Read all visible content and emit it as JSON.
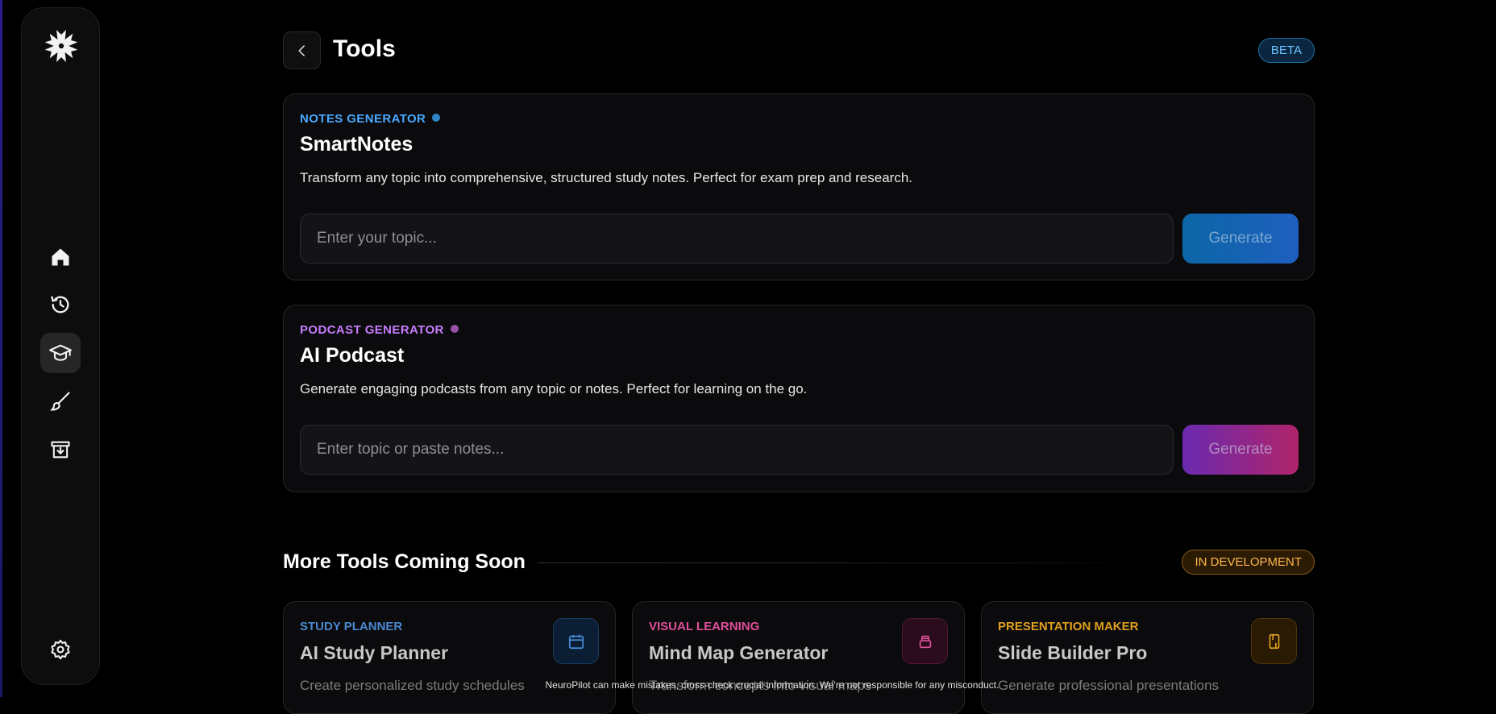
{
  "header": {
    "title": "Tools",
    "badge": "BETA"
  },
  "tools": [
    {
      "eyebrow": "NOTES GENERATOR",
      "title": "SmartNotes",
      "description": "Transform any topic into comprehensive, structured study notes. Perfect for exam prep and research.",
      "placeholder": "Enter your topic...",
      "button": "Generate",
      "accent": "#4aa8ff"
    },
    {
      "eyebrow": "PODCAST GENERATOR",
      "title": "AI Podcast",
      "description": "Generate engaging podcasts from any topic or notes. Perfect for learning on the go.",
      "placeholder": "Enter topic or paste notes...",
      "button": "Generate",
      "accent": "#c87cff"
    }
  ],
  "coming_soon": {
    "title": "More Tools Coming Soon",
    "badge": "IN DEVELOPMENT",
    "cards": [
      {
        "eyebrow": "STUDY PLANNER",
        "title": "AI Study Planner",
        "description": "Create personalized study schedules",
        "icon": "calendar-icon",
        "accent": "#4a88d0"
      },
      {
        "eyebrow": "VISUAL LEARNING",
        "title": "Mind Map Generator",
        "description": "Transform concepts into visual maps",
        "icon": "layers-icon",
        "accent": "#e0509a"
      },
      {
        "eyebrow": "PRESENTATION MAKER",
        "title": "Slide Builder Pro",
        "description": "Generate professional presentations",
        "icon": "slides-icon",
        "accent": "#e0a020"
      }
    ]
  },
  "sidebar": {
    "items": [
      {
        "name": "home",
        "icon": "home-icon"
      },
      {
        "name": "history",
        "icon": "history-icon"
      },
      {
        "name": "tools",
        "icon": "graduation-cap-icon",
        "active": true
      },
      {
        "name": "design",
        "icon": "paintbrush-icon"
      },
      {
        "name": "archive",
        "icon": "archive-download-icon"
      },
      {
        "name": "settings",
        "icon": "gear-icon"
      }
    ]
  },
  "footer": {
    "disclaimer": "NeuroPilot can make mistakes, cross-check crucial information. We're not responsible for any misconduct."
  }
}
